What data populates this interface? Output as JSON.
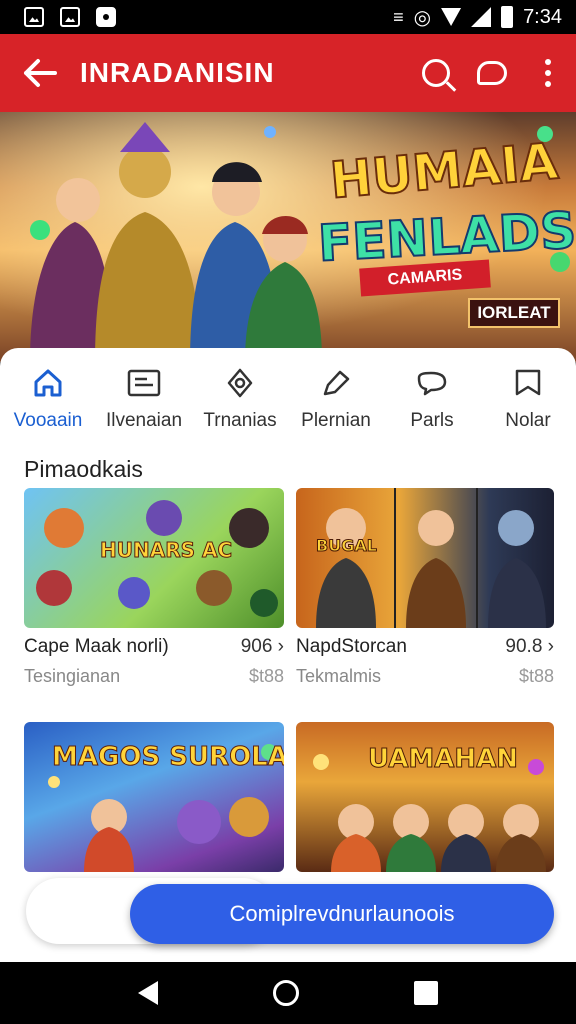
{
  "status_bar": {
    "time": "7:34"
  },
  "app_bar": {
    "title": "INRADANISIN"
  },
  "hero": {
    "title_line1": "HUMAIA",
    "title_line2": "FENLADS",
    "ribbon_text": "CAMARIS",
    "badge_text": "IORLEAT"
  },
  "nav": {
    "items": [
      {
        "label": "Vooaain",
        "icon": "home-icon",
        "active": true
      },
      {
        "label": "Ilvenaian",
        "icon": "store-icon",
        "active": false
      },
      {
        "label": "Trnanias",
        "icon": "controller-icon",
        "active": false
      },
      {
        "label": "Plernian",
        "icon": "tag-icon",
        "active": false
      },
      {
        "label": "Parls",
        "icon": "chat-icon",
        "active": false
      },
      {
        "label": "Nolar",
        "icon": "bookmark-icon",
        "active": false
      }
    ]
  },
  "section": {
    "title": "Pimaodkais"
  },
  "cards": [
    {
      "title": "Cape Maak norli)",
      "price": "906",
      "subtitle": "Tesingianan",
      "sub_price": "$t88",
      "art_text": "HUNARS AC"
    },
    {
      "title": "NapdStorcan",
      "price": "90.8",
      "subtitle": "Tekmalmis",
      "sub_price": "$t88",
      "art_text": "BUGAL"
    },
    {
      "title": "",
      "price": "",
      "subtitle": "",
      "sub_price": "",
      "art_text": "MAGOS SUROLA"
    },
    {
      "title": "",
      "price": "",
      "subtitle": "",
      "sub_price": "",
      "art_text": "UAMAHAN"
    }
  ],
  "cta": {
    "label": "Comiplrevdnurlaunoois"
  },
  "colors": {
    "app_bar": "#d72328",
    "accent": "#2f5fe6",
    "active_nav": "#1b5fd1"
  }
}
